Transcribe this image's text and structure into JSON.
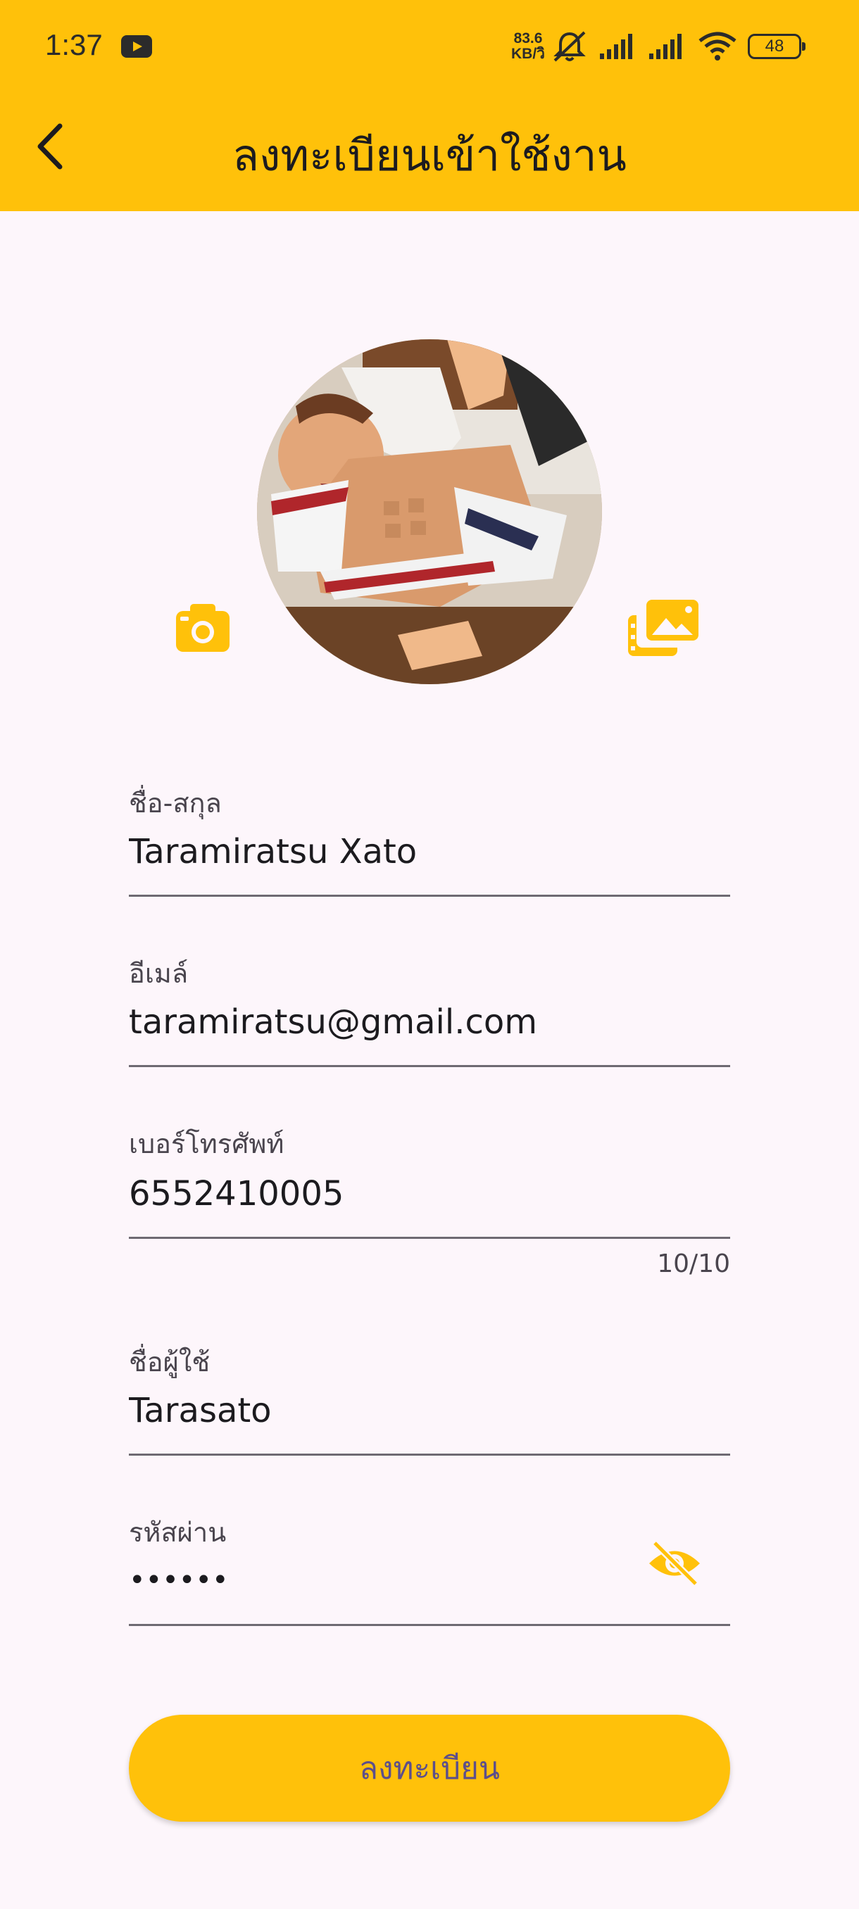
{
  "status_bar": {
    "time": "1:37",
    "network_speed_value": "83.6",
    "network_speed_unit": "KB/วิ",
    "battery": "48"
  },
  "app_bar": {
    "title": "ลงทะเบียนเข้าใช้งาน"
  },
  "form": {
    "fullname": {
      "label": "ชื่อ-สกุล",
      "value": "Taramiratsu Xato"
    },
    "email": {
      "label": "อีเมล์",
      "value": "taramiratsu@gmail.com"
    },
    "phone": {
      "label": "เบอร์โทรศัพท์",
      "value": "6552410005",
      "counter": "10/10"
    },
    "username": {
      "label": "ชื่อผู้ใช้",
      "value": "Tarasato"
    },
    "password": {
      "label": "รหัสผ่าน",
      "value": "••••••"
    }
  },
  "register_button": {
    "label": "ลงทะเบียน"
  },
  "colors": {
    "primary": "#ffc10a",
    "background": "#fdf6fb",
    "button_text": "#5d4f8a"
  },
  "icons": {
    "back": "chevron-left-icon",
    "camera": "camera-icon",
    "gallery": "photo-library-icon",
    "visibility": "visibility-off-icon"
  }
}
